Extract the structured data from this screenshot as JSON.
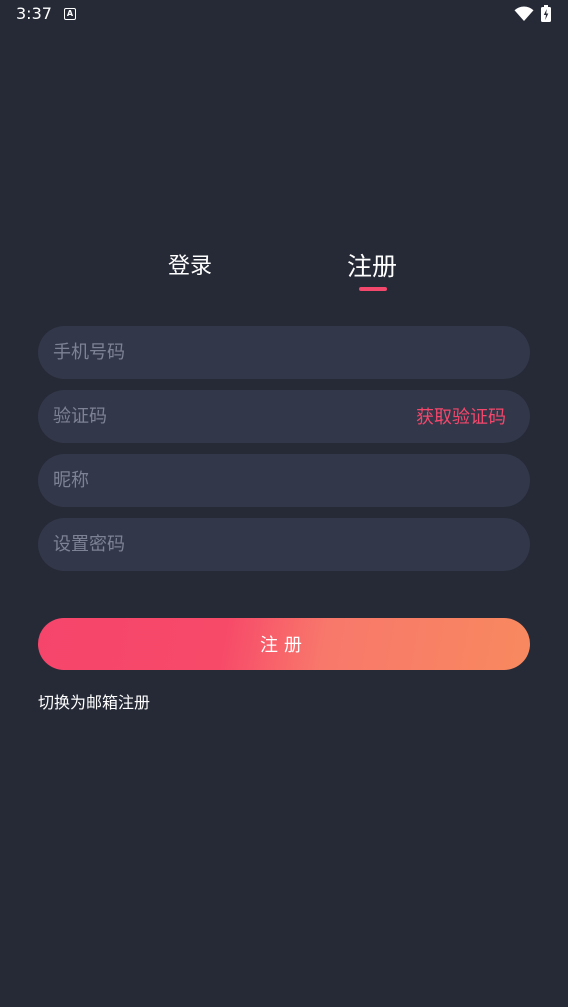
{
  "status_bar": {
    "time": "3:37",
    "notification_icon": "a-icon",
    "wifi_icon": "wifi-icon",
    "battery_icon": "battery-charging-icon"
  },
  "tabs": {
    "login_label": "登录",
    "register_label": "注册",
    "active": "register"
  },
  "form": {
    "phone_placeholder": "手机号码",
    "code_placeholder": "验证码",
    "get_code_label": "获取验证码",
    "nickname_placeholder": "昵称",
    "password_placeholder": "设置密码",
    "submit_label": "注册"
  },
  "switch_link": "切换为邮箱注册",
  "colors": {
    "background": "#262a37",
    "field": "#323749",
    "accent": "#f3476c",
    "gradient_end": "#f8895f"
  }
}
